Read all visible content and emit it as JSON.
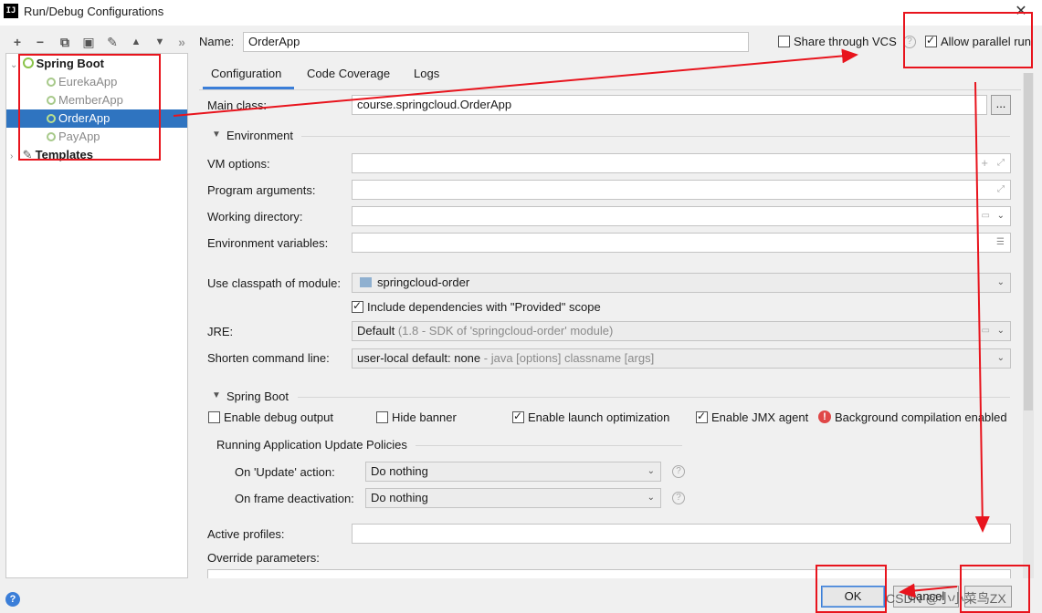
{
  "window": {
    "title": "Run/Debug Configurations",
    "app_icon_text": "IJ"
  },
  "toolbar": {
    "add": "+",
    "remove": "−",
    "copy": "⧉",
    "save": "🖫",
    "edit": "🔧",
    "up": "▲",
    "down": "▼",
    "more": "»"
  },
  "tree": {
    "group_label": "Spring Boot",
    "items": [
      {
        "label": "EurekaApp"
      },
      {
        "label": "MemberApp"
      },
      {
        "label": "OrderApp"
      },
      {
        "label": "PayApp"
      }
    ],
    "templates_label": "Templates"
  },
  "header": {
    "name_label": "Name:",
    "name_value": "OrderApp",
    "share_label": "Share through VCS",
    "allow_parallel_label": "Allow parallel run"
  },
  "tabs": [
    "Configuration",
    "Code Coverage",
    "Logs"
  ],
  "config": {
    "main_class_label": "Main class:",
    "main_class_value": "course.springcloud.OrderApp",
    "browse_label": "...",
    "environment_title": "Environment",
    "vm_options_label": "VM options:",
    "program_args_label": "Program arguments:",
    "working_dir_label": "Working directory:",
    "env_vars_label": "Environment variables:",
    "classpath_label": "Use classpath of module:",
    "classpath_value": "springcloud-order",
    "include_deps_label": "Include dependencies with \"Provided\" scope",
    "jre_label": "JRE:",
    "jre_value": "Default",
    "jre_hint": "(1.8 - SDK of 'springcloud-order' module)",
    "shorten_label": "Shorten command line:",
    "shorten_value": "user-local default: none",
    "shorten_hint": "- java [options] classname [args]"
  },
  "spring_boot": {
    "title": "Spring Boot",
    "debug_output": "Enable debug output",
    "hide_banner": "Hide banner",
    "launch_opt": "Enable launch optimization",
    "jmx_agent": "Enable JMX agent",
    "bg_compilation": "Background compilation enabled",
    "policies_title": "Running Application Update Policies",
    "update_action_label": "On 'Update' action:",
    "update_action_value": "Do nothing",
    "frame_deact_label": "On frame deactivation:",
    "frame_deact_value": "Do nothing",
    "active_profiles_label": "Active profiles:",
    "override_params_label": "Override parameters:"
  },
  "footer": {
    "ok_label": "OK",
    "cancel_label": "Cancel",
    "help_label": "?",
    "watermark": "CSDN @小小菜鸟ZX"
  },
  "colors": {
    "selection": "#2f74c0",
    "annotation_red": "#e8141d",
    "tab_underline": "#3b7ed8"
  }
}
